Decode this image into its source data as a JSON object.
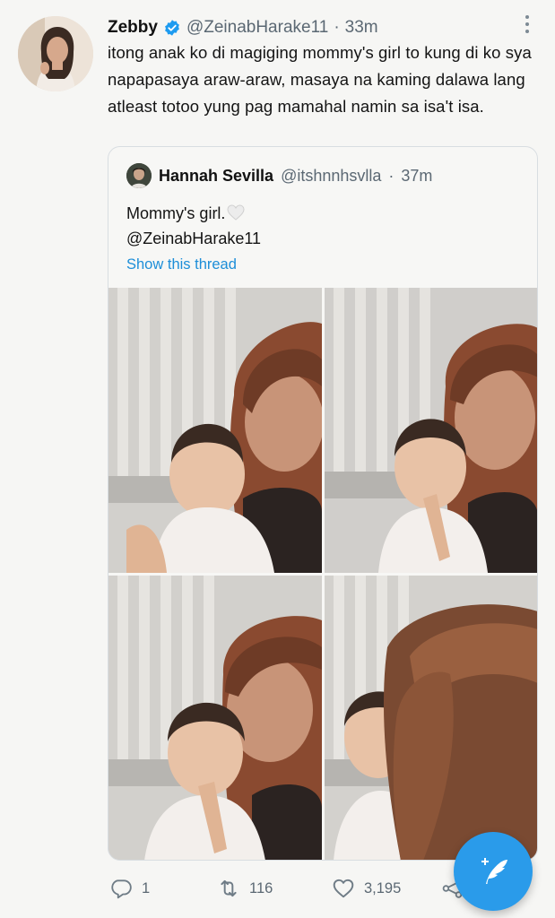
{
  "tweet": {
    "display_name": "Zebby",
    "handle": "@ZeinabHarake11",
    "separator": "·",
    "time": "33m",
    "text": "itong anak ko di magiging mommy's girl to kung di ko sya napapasaya araw-araw, masaya na kaming dalawa lang atleast totoo yung pag mamahal namin sa isa't isa."
  },
  "quoted_tweet": {
    "display_name": "Hannah Sevilla",
    "handle": "@itshnnhsvlla",
    "separator": "·",
    "time": "37m",
    "text": "Mommy's girl.",
    "mention": "@ZeinabHarake11",
    "show_thread": "Show this thread",
    "photo_count": 4
  },
  "actions": {
    "reply_count": "1",
    "retweet_count": "116",
    "like_count": "3,195"
  },
  "icons": {
    "verified": "verified-badge-icon",
    "more": "more-vertical-icon",
    "reply": "reply-icon",
    "retweet": "retweet-icon",
    "like": "heart-icon",
    "share": "share-icon",
    "compose": "compose-tweet-icon"
  },
  "colors": {
    "background": "#f6f6f4",
    "accent": "#1d9bf0",
    "fab": "#2a9bea",
    "muted": "#5b6873"
  }
}
